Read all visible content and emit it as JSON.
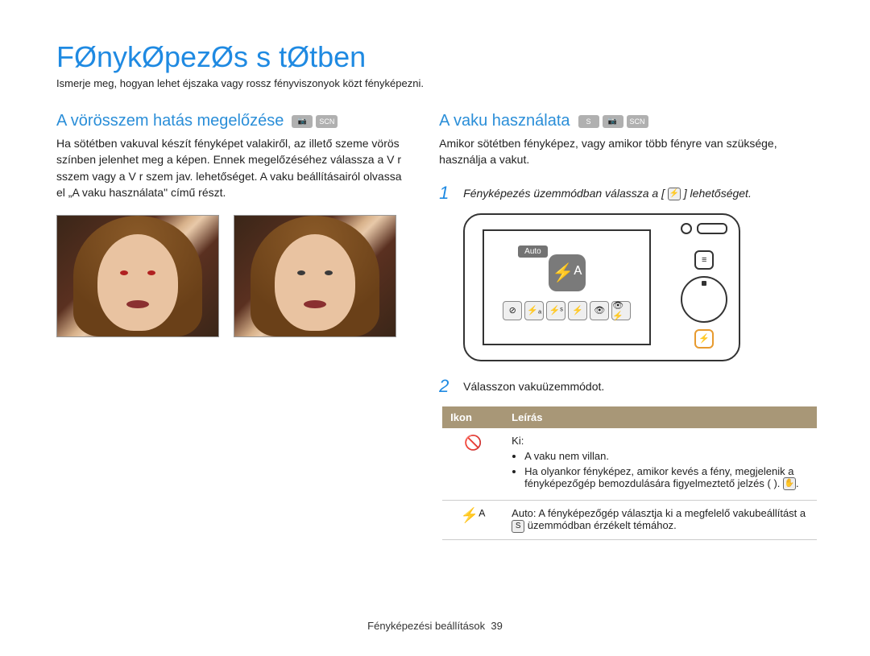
{
  "title": "FØnykØpezØs s tØtben",
  "subtitle": "Ismerje meg, hogyan lehet éjszaka vagy rossz fényviszonyok közt fényképezni.",
  "left": {
    "heading": "A vörösszem hatás megelőzése",
    "body": "Ha sötétben vakuval készít fényképet valakiről, az illető szeme vörös színben jelenhet meg a képen. Ennek megelőzéséhez válassza a V r sszem vagy a V r szem jav. lehetőséget. A vaku beállításairól olvassa el „A vaku használata\" című részt."
  },
  "right": {
    "heading": "A vaku használata",
    "body": "Amikor sötétben fényképez, vagy amikor több fényre van szüksége, használja a vakut.",
    "step1_pre": "Fényképezés üzemmódban válassza a [",
    "step1_post": "] lehetőséget.",
    "step2": "Válasszon vakuüzemmódot.",
    "camera_label": "Auto",
    "table": {
      "col_icon": "Ikon",
      "col_desc": "Leírás",
      "row1": {
        "title": "Ki:",
        "b1": "A vaku nem villan.",
        "b2": "Ha olyankor fényképez, amikor kevés a fény, megjelenik a fényképezőgép bemozdulására figyelmeztető jelzés (   )."
      },
      "row2": {
        "text_pre": "Auto: A fényképezőgép választja ki a megfelelő vakubeállítást a ",
        "text_post": " üzemmódban érzékelt témához."
      }
    }
  },
  "footer": {
    "label": "Fényképezési beállítások",
    "page": "39"
  }
}
